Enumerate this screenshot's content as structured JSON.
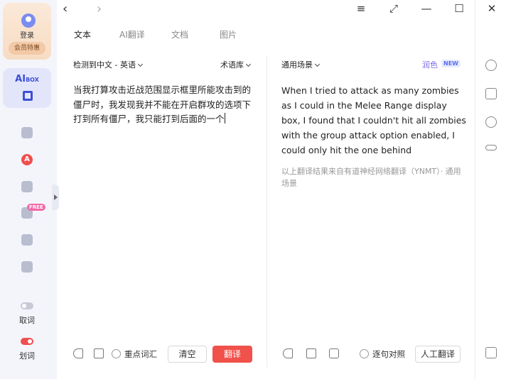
{
  "sidebar": {
    "login_label": "登录",
    "vip_label": "会员特惠",
    "aibox_label": "AI",
    "aibox_sub": "BOX",
    "free_badge": "FREE",
    "icons": [
      "search-icon",
      "a-circle-icon",
      "pen-icon",
      "graduation-cap-icon",
      "document-icon",
      "edit-icon"
    ],
    "toggle_pick": {
      "label": "取词",
      "state": "off"
    },
    "toggle_select": {
      "label": "划词",
      "state": "on"
    }
  },
  "topbar": {
    "back_symbol": "‹",
    "forward_symbol": "›",
    "menu_symbol": "≡",
    "mini_symbol": "⤢",
    "minimize_symbol": "—",
    "maximize_symbol": "☐",
    "close_symbol": "✕"
  },
  "tabs": [
    "文本",
    "AI翻译",
    "文档",
    "图片"
  ],
  "source": {
    "lang_select": "检测到中文 - 英语",
    "glossary": "术语库",
    "text": "当我打算攻击近战范围显示框里所能攻击到的僵尸时，我发现我并不能在开启群攻的选项下打到所有僵尸，我只能打到后面的一个",
    "key_words_label": "重点词汇",
    "clear_label": "清空",
    "translate_label": "翻译"
  },
  "target": {
    "scene_select": "通用场景",
    "polish_label": "润色",
    "new_badge": "NEW",
    "text": "When I tried to attack as many zombies as I could in the Melee Range display box, I found that I couldn't hit all zombies with the group attack option enabled, I could only hit the one behind",
    "attribution": "以上翻译结果来自有道神经网络翻译（YNMT）· 通用场景",
    "sentence_align_label": "逐句对照",
    "human_translate_label": "人工翻译"
  },
  "colors": {
    "accent": "#f0514a",
    "brand_blue": "#3d4fd6",
    "polish_purple": "#7b6be6"
  }
}
